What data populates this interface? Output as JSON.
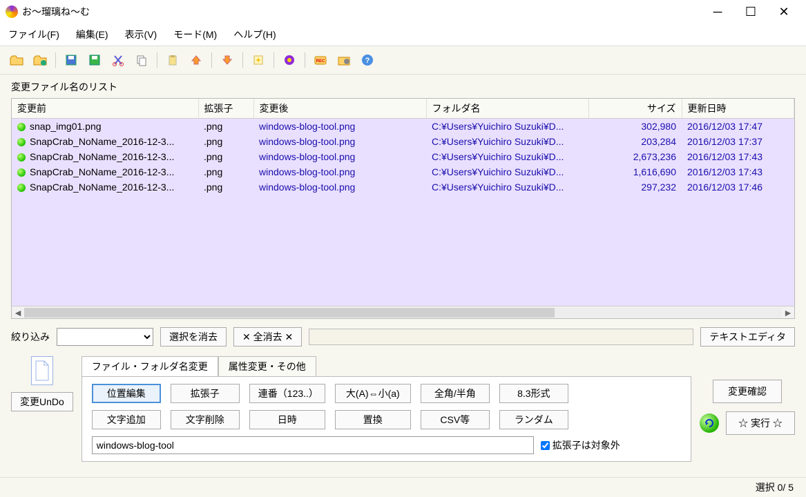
{
  "window": {
    "title": "お～瑠璃ね～む"
  },
  "menu": {
    "file": "ファイル(F)",
    "edit": "編集(E)",
    "view": "表示(V)",
    "mode": "モード(M)",
    "help": "ヘルプ(H)"
  },
  "list_label": "変更ファイル名のリスト",
  "columns": {
    "before": "変更前",
    "ext": "拡張子",
    "after": "変更後",
    "folder": "フォルダ名",
    "size": "サイズ",
    "date": "更新日時"
  },
  "rows": [
    {
      "name": "snap_img01.png",
      "ext": ".png",
      "after": "windows-blog-tool.png",
      "folder": "C:¥Users¥Yuichiro Suzuki¥D...",
      "size": "302,980",
      "date": "2016/12/03 17:47"
    },
    {
      "name": "SnapCrab_NoName_2016-12-3...",
      "ext": ".png",
      "after": "windows-blog-tool.png",
      "folder": "C:¥Users¥Yuichiro Suzuki¥D...",
      "size": "203,284",
      "date": "2016/12/03 17:37"
    },
    {
      "name": "SnapCrab_NoName_2016-12-3...",
      "ext": ".png",
      "after": "windows-blog-tool.png",
      "folder": "C:¥Users¥Yuichiro Suzuki¥D...",
      "size": "2,673,236",
      "date": "2016/12/03 17:43"
    },
    {
      "name": "SnapCrab_NoName_2016-12-3...",
      "ext": ".png",
      "after": "windows-blog-tool.png",
      "folder": "C:¥Users¥Yuichiro Suzuki¥D...",
      "size": "1,616,690",
      "date": "2016/12/03 17:43"
    },
    {
      "name": "SnapCrab_NoName_2016-12-3...",
      "ext": ".png",
      "after": "windows-blog-tool.png",
      "folder": "C:¥Users¥Yuichiro Suzuki¥D...",
      "size": "297,232",
      "date": "2016/12/03 17:46"
    }
  ],
  "filter": {
    "label": "絞り込み",
    "clear_selection": "選択を消去",
    "clear_all": "✕  全消去  ✕",
    "text_editor": "テキストエディタ"
  },
  "undo": {
    "button": "変更UnDo"
  },
  "tabs": {
    "rename": "ファイル・フォルダ名変更",
    "attrs": "属性変更・その他"
  },
  "mode_buttons": {
    "position": "位置編集",
    "ext": "拡張子",
    "serial": "連番（123..）",
    "case": "大(A)⇔小(a)",
    "width": "全角/半角",
    "fmt83": "8.3形式",
    "addchar": "文字追加",
    "delchar": "文字削除",
    "datetime": "日時",
    "replace": "置換",
    "csv": "CSV等",
    "random": "ランダム"
  },
  "input": {
    "value": "windows-blog-tool",
    "checkbox_label": "拡張子は対象外"
  },
  "right": {
    "confirm": "変更確認",
    "execute": "☆ 実行 ☆"
  },
  "status": "選択  0/  5"
}
